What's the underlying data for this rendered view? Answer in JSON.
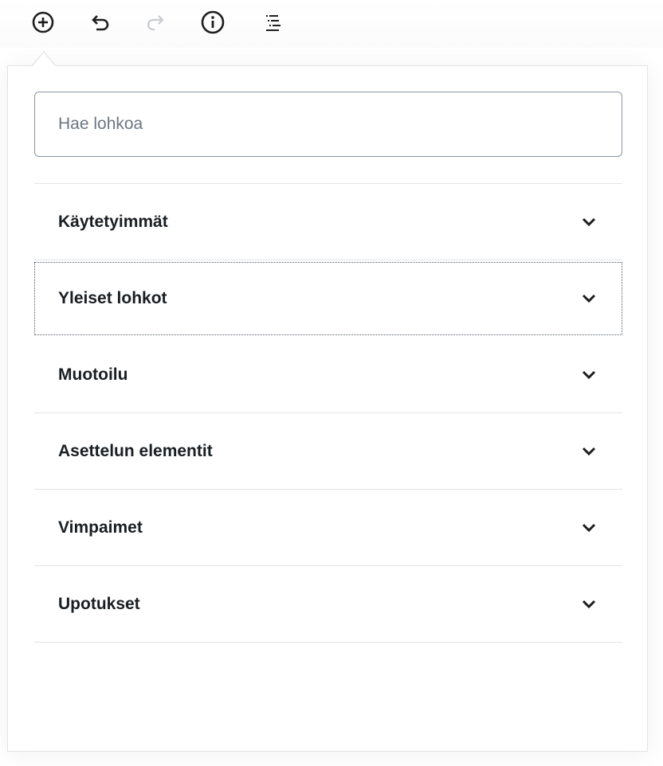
{
  "toolbar": {
    "buttons": [
      {
        "name": "add-block",
        "icon": "plus-circle-icon",
        "enabled": true
      },
      {
        "name": "undo",
        "icon": "undo-icon",
        "enabled": true
      },
      {
        "name": "redo",
        "icon": "redo-icon",
        "enabled": false
      },
      {
        "name": "content-structure",
        "icon": "info-icon",
        "enabled": true
      },
      {
        "name": "block-navigation",
        "icon": "list-view-icon",
        "enabled": true
      }
    ]
  },
  "inserter": {
    "search": {
      "placeholder": "Hae lohkoa",
      "value": ""
    },
    "categories": [
      {
        "label": "Käytetyimmät",
        "expanded": false,
        "focused": false
      },
      {
        "label": "Yleiset lohkot",
        "expanded": false,
        "focused": true
      },
      {
        "label": "Muotoilu",
        "expanded": false,
        "focused": false
      },
      {
        "label": "Asettelun elementit",
        "expanded": false,
        "focused": false
      },
      {
        "label": "Vimpaimet",
        "expanded": false,
        "focused": false
      },
      {
        "label": "Upotukset",
        "expanded": false,
        "focused": false
      }
    ]
  },
  "colors": {
    "icon": "#1e1e1e",
    "icon_disabled": "#c8cbcf",
    "border": "#e2e4e7",
    "input_border": "#8d96a0",
    "placeholder": "#6c7781"
  }
}
